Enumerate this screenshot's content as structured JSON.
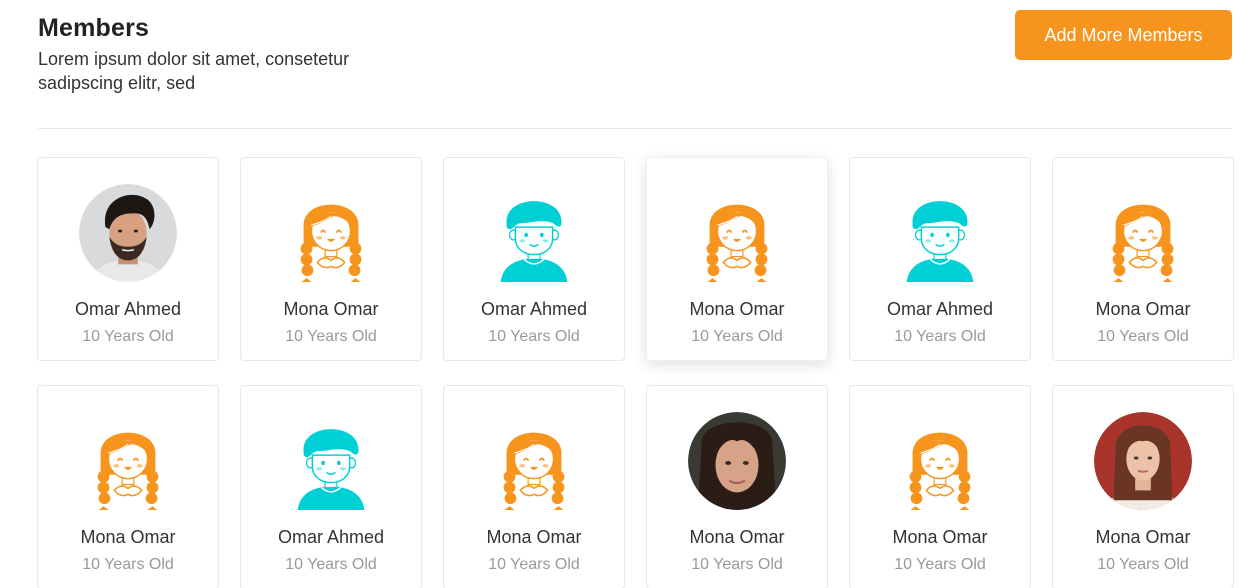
{
  "header": {
    "title": "Members",
    "subtitle": "Lorem ipsum dolor sit amet, consetetur sadipscing elitr, sed"
  },
  "actions": {
    "add_members_label": "Add More Members"
  },
  "colors": {
    "accent": "#f7941d",
    "teal": "#00d0d6"
  },
  "members": [
    {
      "name": "Omar Ahmed",
      "age": "10 Years Old",
      "avatar": "photo-man-beard"
    },
    {
      "name": "Mona Omar",
      "age": "10 Years Old",
      "avatar": "cartoon-girl"
    },
    {
      "name": "Omar Ahmed",
      "age": "10 Years Old",
      "avatar": "cartoon-boy"
    },
    {
      "name": "Mona Omar",
      "age": "10 Years Old",
      "avatar": "cartoon-girl",
      "selected": true
    },
    {
      "name": "Omar Ahmed",
      "age": "10 Years Old",
      "avatar": "cartoon-boy"
    },
    {
      "name": "Mona Omar",
      "age": "10 Years Old",
      "avatar": "cartoon-girl"
    },
    {
      "name": "Mona Omar",
      "age": "10 Years Old",
      "avatar": "cartoon-girl"
    },
    {
      "name": "Omar Ahmed",
      "age": "10 Years Old",
      "avatar": "cartoon-boy"
    },
    {
      "name": "Mona Omar",
      "age": "10 Years Old",
      "avatar": "cartoon-girl"
    },
    {
      "name": "Mona Omar",
      "age": "10 Years Old",
      "avatar": "photo-woman-dark-hair"
    },
    {
      "name": "Mona Omar",
      "age": "10 Years Old",
      "avatar": "cartoon-girl"
    },
    {
      "name": "Mona Omar",
      "age": "10 Years Old",
      "avatar": "photo-woman-auburn-hair"
    }
  ]
}
